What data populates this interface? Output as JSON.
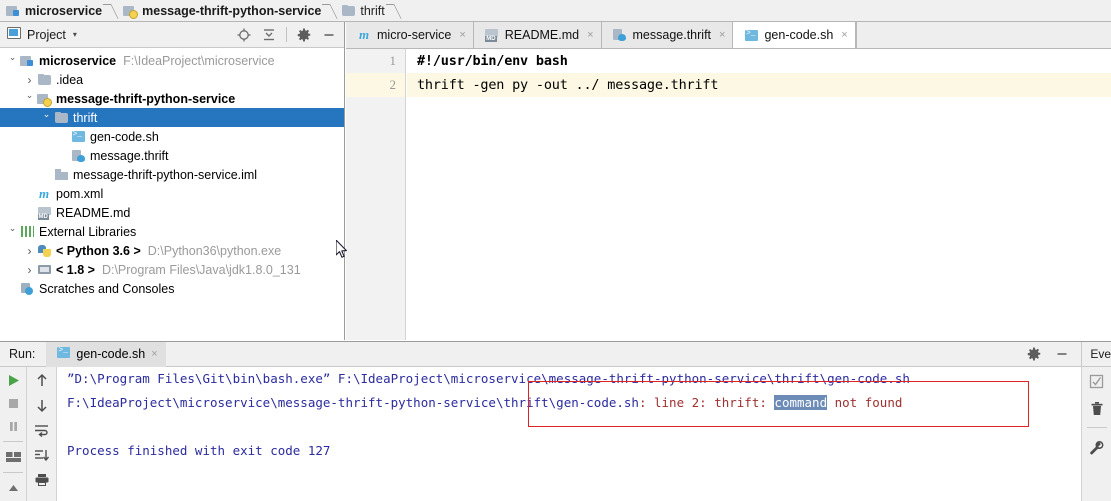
{
  "breadcrumb": {
    "items": [
      {
        "label": "microservice",
        "icon": "module-icon",
        "bold": true
      },
      {
        "label": "message-thrift-python-service",
        "icon": "python-module-icon",
        "bold": true
      },
      {
        "label": "thrift",
        "icon": "folder-icon",
        "bold": false
      }
    ]
  },
  "project_panel": {
    "title": "Project",
    "caret": "▾",
    "tools": [
      "locate-icon",
      "collapse-all-icon",
      "settings-gear-icon",
      "minimize-icon"
    ],
    "tree": [
      {
        "indent": 0,
        "arrow": "open",
        "icon": "module-icon",
        "name": "microservice",
        "bold": true,
        "path": "F:\\IdeaProject\\microservice",
        "selected": false
      },
      {
        "indent": 1,
        "arrow": "closed",
        "icon": "folder-icon",
        "name": ".idea",
        "bold": false,
        "path": "",
        "selected": false
      },
      {
        "indent": 1,
        "arrow": "open",
        "icon": "python-module-icon",
        "name": "message-thrift-python-service",
        "bold": true,
        "path": "",
        "selected": false
      },
      {
        "indent": 2,
        "arrow": "open",
        "icon": "folder-icon",
        "name": "thrift",
        "bold": false,
        "path": "",
        "selected": true
      },
      {
        "indent": 3,
        "arrow": "none",
        "icon": "shell-script-icon",
        "name": "gen-code.sh",
        "bold": false,
        "path": "",
        "selected": false
      },
      {
        "indent": 3,
        "arrow": "none",
        "icon": "thrift-file-icon",
        "name": "message.thrift",
        "bold": false,
        "path": "",
        "selected": false
      },
      {
        "indent": 2,
        "arrow": "none",
        "icon": "iml-file-icon",
        "name": "message-thrift-python-service.iml",
        "bold": false,
        "path": "",
        "selected": false
      },
      {
        "indent": 1,
        "arrow": "none",
        "icon": "maven-file-icon",
        "name": "pom.xml",
        "bold": false,
        "path": "",
        "selected": false
      },
      {
        "indent": 1,
        "arrow": "none",
        "icon": "markdown-file-icon",
        "name": "README.md",
        "bold": false,
        "path": "",
        "selected": false
      },
      {
        "indent": 0,
        "arrow": "open",
        "icon": "library-icon",
        "name": "External Libraries",
        "bold": false,
        "path": "",
        "selected": false
      },
      {
        "indent": 1,
        "arrow": "closed",
        "icon": "python-sdk-icon",
        "name": "< Python 3.6 >",
        "bold": true,
        "path": "D:\\Python36\\python.exe",
        "selected": false
      },
      {
        "indent": 1,
        "arrow": "closed",
        "icon": "jdk-icon",
        "name": "< 1.8 >",
        "bold": true,
        "path": "D:\\Program Files\\Java\\jdk1.8.0_131",
        "selected": false
      },
      {
        "indent": 0,
        "arrow": "none",
        "icon": "scratches-icon",
        "name": "Scratches and Consoles",
        "bold": false,
        "path": "",
        "selected": false
      }
    ]
  },
  "editor": {
    "tabs": [
      {
        "label": "micro-service",
        "icon": "maven-file-icon",
        "active": false,
        "close": "×"
      },
      {
        "label": "README.md",
        "icon": "markdown-file-icon",
        "active": false,
        "close": "×"
      },
      {
        "label": "message.thrift",
        "icon": "thrift-file-icon",
        "active": false,
        "close": "×"
      },
      {
        "label": "gen-code.sh",
        "icon": "shell-script-icon",
        "active": true,
        "close": "×"
      }
    ],
    "lines": [
      {
        "no": "1",
        "text": "#!/usr/bin/env bash",
        "bold": true,
        "highlight": false
      },
      {
        "no": "2",
        "text": "thrift -gen py -out ../ message.thrift",
        "bold": false,
        "highlight": true
      }
    ]
  },
  "run_panel": {
    "label": "Run:",
    "tab": {
      "label": "gen-code.sh",
      "icon": "shell-script-icon",
      "close": "×"
    },
    "tools": [
      "settings-gear-icon",
      "minimize-icon"
    ],
    "event_log": "Eve",
    "left_toolbar": [
      "run-icon",
      "stop-icon",
      "pause-icon",
      "layout-icon",
      "up-icon"
    ],
    "left_toolbar2": [
      "arrow-up-icon",
      "arrow-down-icon",
      "soft-wrap-icon",
      "scroll-to-end-icon",
      "print-icon"
    ],
    "right_toolbar": [
      "checkbox-icon",
      "trash-icon",
      "wrench-icon"
    ],
    "console": {
      "line1": "”D:\\Program Files\\Git\\bin\\bash.exe” F:\\IdeaProject\\microservice\\message-thrift-python-service\\thrift\\gen-code.sh",
      "line2_link": "F:\\IdeaProject\\microservice\\message-thrift-python-service\\thrift\\gen-code.sh",
      "line2_rest_a": ": line 2: thrift: ",
      "line2_selected": "command",
      "line2_rest_b": " not found",
      "line3": "",
      "line4": "Process finished with exit code 127"
    }
  },
  "colors": {
    "selection_blue": "#2675bf",
    "annotation_red": "#e02222",
    "console_blue": "#2b2b9e",
    "console_error_red": "#a03030",
    "word_selection": "#6d8bb7",
    "current_line": "#fdf8e3"
  }
}
